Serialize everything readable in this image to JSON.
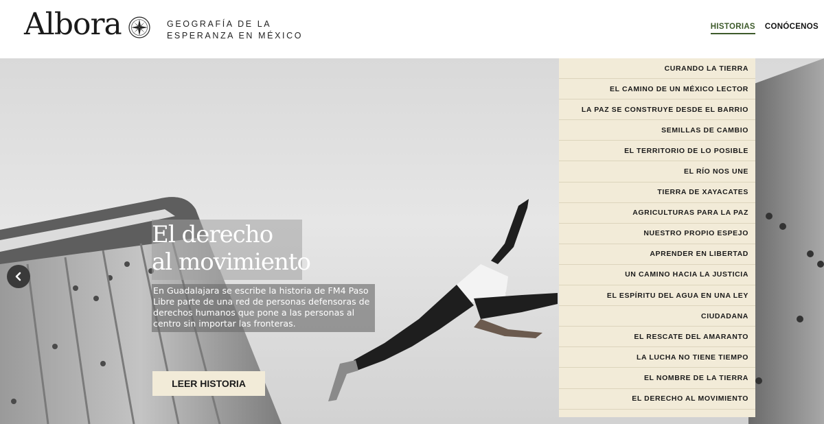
{
  "header": {
    "logo": "Albora",
    "tagline_line1": "GEOGRAFÍA DE LA",
    "tagline_line2": "ESPERANZA EN MÉXICO",
    "nav": [
      {
        "label": "HISTORIAS",
        "active": true
      },
      {
        "label": "CONÓCENOS",
        "active": false
      }
    ]
  },
  "hero": {
    "title_line1": "El derecho",
    "title_line2": "al movimiento",
    "description": "En Guadalajara se escribe la historia de FM4 Paso Libre parte de una red de personas defensoras de derechos humanos que pone a las personas al centro sin importar las fronteras.",
    "cta_label": "LEER HISTORIA",
    "prev_icon": "chevron-left-icon"
  },
  "stories": [
    "CURANDO LA TIERRA",
    "EL CAMINO DE UN MÉXICO LECTOR",
    "LA PAZ SE CONSTRUYE DESDE EL BARRIO",
    "SEMILLAS DE CAMBIO",
    "EL TERRITORIO DE LO POSIBLE",
    "EL RÍO NOS UNE",
    "TIERRA DE XAYACATES",
    "AGRICULTURAS PARA LA PAZ",
    "NUESTRO PROPIO ESPEJO",
    "APRENDER EN LIBERTAD",
    "UN CAMINO HACIA LA JUSTICIA",
    "EL ESPÍRITU DEL AGUA EN UNA LEY",
    "CIUDADANA",
    "EL RESCATE DEL AMARANTO",
    "LA LUCHA NO TIENE TIEMPO",
    "EL NOMBRE DE LA TIERRA",
    "EL DERECHO AL MOVIMIENTO"
  ],
  "colors": {
    "accent_green": "#3d5a2a",
    "menu_bg": "#f2ebd8",
    "cta_bg": "#f2ebd8"
  }
}
